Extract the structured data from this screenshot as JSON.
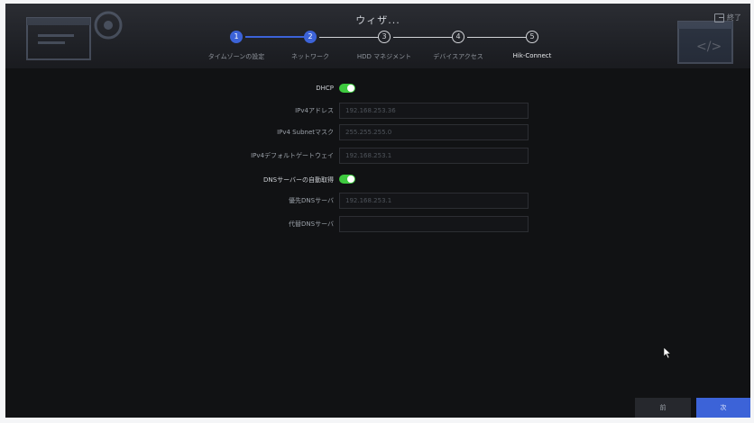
{
  "header": {
    "title": "ウィザ...",
    "exit_label": "終了"
  },
  "steps": [
    {
      "number": "1",
      "label": "タイムゾーンの設定",
      "state": "done"
    },
    {
      "number": "2",
      "label": "ネットワーク",
      "state": "done"
    },
    {
      "number": "3",
      "label": "HDD マネジメント",
      "state": "todo"
    },
    {
      "number": "4",
      "label": "デバイスアクセス",
      "state": "todo"
    },
    {
      "number": "5",
      "label": "Hik-Connect",
      "state": "active"
    }
  ],
  "form": {
    "dhcp": {
      "label": "DHCP",
      "enabled": true
    },
    "ipv4_address": {
      "label": "IPv4アドレス",
      "value": "192.168.253.36"
    },
    "subnet_mask": {
      "label": "IPv4 Subnetマスク",
      "value": "255.255.255.0"
    },
    "gateway": {
      "label": "IPv4デフォルトゲートウェイ",
      "value": "192.168.253.1"
    },
    "dns_auto": {
      "label": "DNSサーバーの自動取得",
      "enabled": true
    },
    "preferred_dns": {
      "label": "優先DNSサーバ",
      "value": "192.168.253.1"
    },
    "alternate_dns": {
      "label": "代替DNSサーバ",
      "value": ""
    }
  },
  "footer": {
    "prev_label": "前",
    "next_label": "次"
  },
  "colors": {
    "accent": "#3c63d8",
    "toggle_on": "#3ec93f",
    "background": "#111214"
  }
}
